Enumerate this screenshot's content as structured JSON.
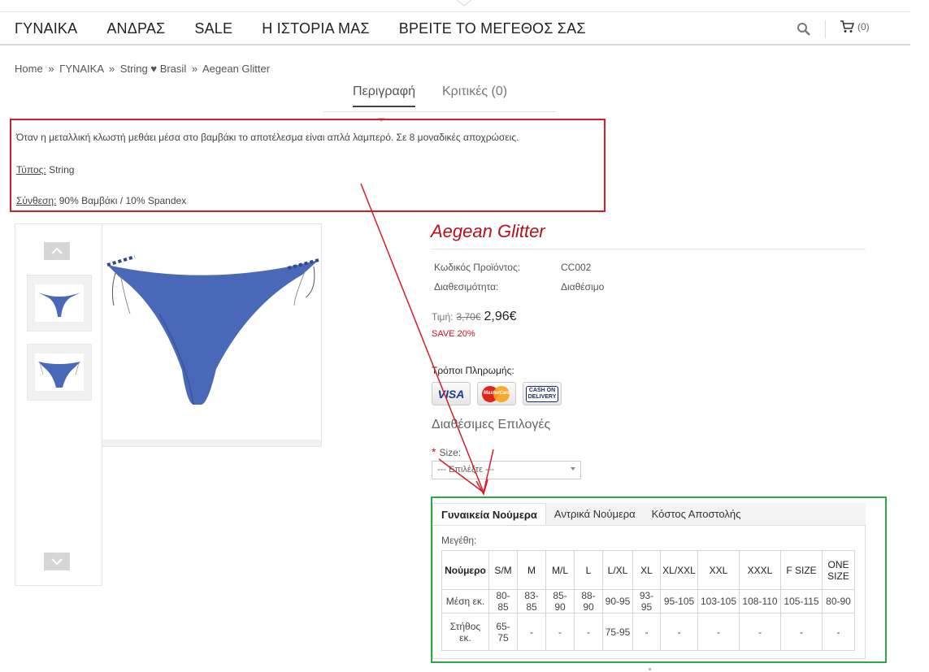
{
  "nav": {
    "items": [
      "ΓΥΝΑΙΚΑ",
      "ΑΝΔΡΑΣ",
      "SALE",
      "Η ΙΣΤΟΡΙΑ ΜΑΣ",
      "ΒΡΕΙΤΕ ΤΟ ΜΕΓΕΘΟΣ ΣΑΣ"
    ],
    "cart_count": "(0)"
  },
  "breadcrumb": [
    "Home",
    "ΓΥΝΑΙΚΑ",
    "String ♥ Brasil",
    "Aegean Glitter"
  ],
  "breadcrumb_sep": "»",
  "desc_tabs": {
    "description": "Περιγραφή",
    "reviews": "Κριτικές (0)"
  },
  "description": {
    "text": "Όταν η μεταλλική κλωστή μεθάει μέσα στο βαμβάκι το αποτέλεσμα είναι απλά λαμπερό. Σε 8 μοναδικές αποχρώσεις.",
    "type_label": "Τύπος:",
    "type_value": " String",
    "composition_label": "Σύνθεση:",
    "composition_value": " 90% Βαμβάκι / 10% Spandex"
  },
  "product": {
    "title": "Aegean Glitter",
    "code_label": "Κωδικός Προϊόντος:",
    "code_value": "CC002",
    "availability_label": "Διαθεσιμότητα:",
    "availability_value": "Διαθέσιμο",
    "price_label": "Τιμή:",
    "price_old": "3,70€",
    "price_new": "2,96€",
    "save": "SAVE 20%",
    "payment_label": "Τρόποι Πληρωμής:",
    "payment_visa": "VISA",
    "payment_mc": "MasterCard",
    "payment_cod_1": "CASH ON",
    "payment_cod_2": "DELIVERY",
    "options_title": "Διαθέσιμες Επιλογές",
    "size_label": "Size:",
    "size_required": "*",
    "size_placeholder": "--- Επιλέξτε ---"
  },
  "sizes": {
    "tabs": [
      "Γυναικεία Νούμερα",
      "Αντρικά Νούμερα",
      "Κόστος Αποστολής"
    ],
    "title": "Μεγέθη:",
    "header": [
      "Νούμερο",
      "S/M",
      "M",
      "M/L",
      "L",
      "L/XL",
      "XL",
      "XL/XXL",
      "XXL",
      "XXXL",
      "F SIZE",
      "ONE SIZE"
    ],
    "rows": [
      [
        "Μέση εκ.",
        "80-85",
        "83-85",
        "85-90",
        "88-90",
        "90-95",
        "93-95",
        "95-105",
        "103-105",
        "108-110",
        "105-115",
        "80-90"
      ],
      [
        "Στήθος εκ.",
        "65-75",
        "-",
        "-",
        "-",
        "75-95",
        "-",
        "-",
        "-",
        "-",
        "-",
        "-"
      ]
    ]
  },
  "colors": {
    "title_red": "#b5121b",
    "annotation_red": "#d21f2a",
    "annotation_green": "#2ea843",
    "product_blue": "#4a68b8"
  }
}
